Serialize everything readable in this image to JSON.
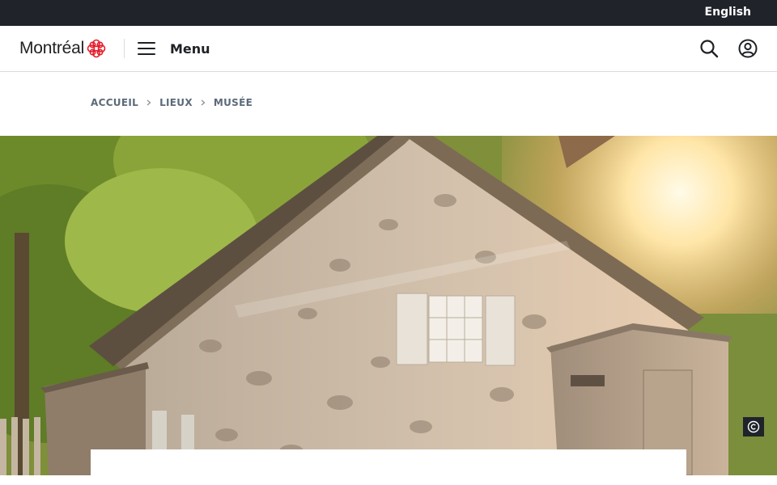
{
  "topbar": {
    "language_link": "English"
  },
  "header": {
    "logo_text": "Montréal",
    "menu_label": "Menu"
  },
  "breadcrumb": {
    "items": [
      "ACCUEIL",
      "LIEUX",
      "MUSÉE"
    ]
  },
  "hero": {
    "description_icon": "copyright-icon"
  },
  "colors": {
    "topbar": "#20232a",
    "brand_red": "#e41a2a",
    "breadcrumb_text": "#5c6a79"
  }
}
